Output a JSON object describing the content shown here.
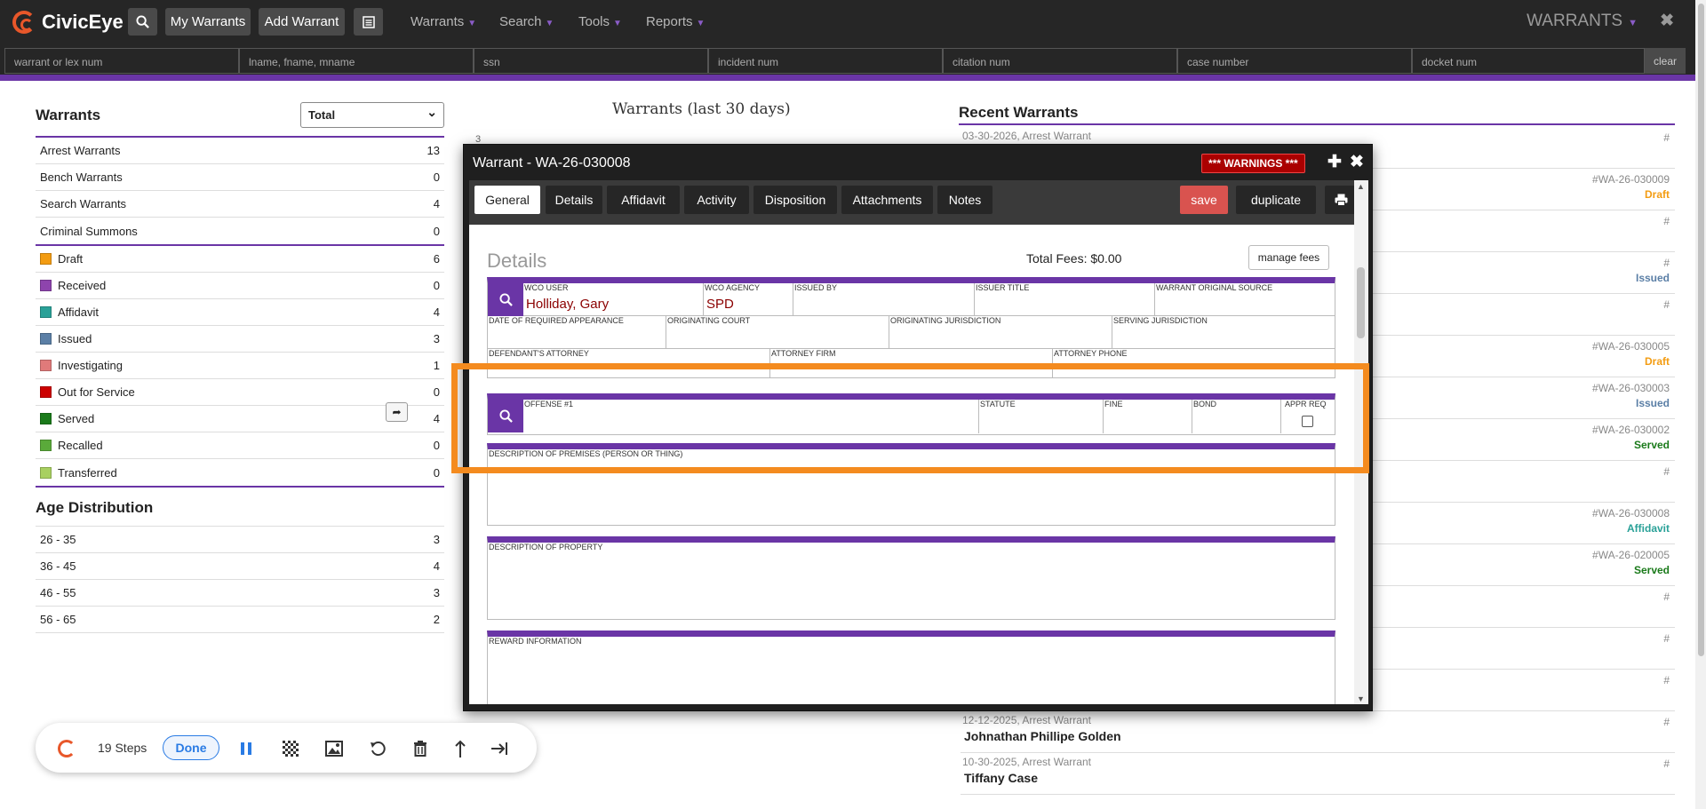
{
  "app": {
    "brand": "CivicEye",
    "module_title": "WARRANTS"
  },
  "topbar": {
    "my_warrants": "My Warrants",
    "add_warrant": "Add Warrant",
    "menus": [
      "Warrants",
      "Search",
      "Tools",
      "Reports"
    ]
  },
  "search": {
    "placeholders": [
      "warrant or lex num",
      "lname, fname, mname",
      "ssn",
      "incident num",
      "citation num",
      "case number",
      "docket num"
    ],
    "clear": "clear"
  },
  "left": {
    "title": "Warrants",
    "select_value": "Total",
    "types": [
      {
        "label": "Arrest Warrants",
        "count": "13"
      },
      {
        "label": "Bench Warrants",
        "count": "0"
      },
      {
        "label": "Search Warrants",
        "count": "4"
      },
      {
        "label": "Criminal Summons",
        "count": "0"
      }
    ],
    "statuses": [
      {
        "label": "Draft",
        "count": "6",
        "color": "#f39c12"
      },
      {
        "label": "Received",
        "count": "0",
        "color": "#8e44ad"
      },
      {
        "label": "Affidavit",
        "count": "4",
        "color": "#2aa198"
      },
      {
        "label": "Issued",
        "count": "3",
        "color": "#5b7fa6"
      },
      {
        "label": "Investigating",
        "count": "1",
        "color": "#e07a7a"
      },
      {
        "label": "Out for Service",
        "count": "0",
        "color": "#cc0000"
      },
      {
        "label": "Served",
        "count": "4",
        "color": "#1a7a1a"
      },
      {
        "label": "Recalled",
        "count": "0",
        "color": "#5aaa3a"
      },
      {
        "label": "Transferred",
        "count": "0",
        "color": "#a8d060"
      }
    ],
    "age_title": "Age Distribution",
    "ages": [
      {
        "label": "26 - 35",
        "count": "3"
      },
      {
        "label": "36 - 45",
        "count": "4"
      },
      {
        "label": "46 - 55",
        "count": "3"
      },
      {
        "label": "56 - 65",
        "count": "2"
      }
    ]
  },
  "chart": {
    "title": "Warrants (last 30 days)",
    "tick": "3"
  },
  "recent": {
    "title": "Recent Warrants",
    "items": [
      {
        "date": "03-30-2026, Arrest Warrant",
        "name": "",
        "num": "#",
        "status": "",
        "status_color": ""
      },
      {
        "date": "",
        "name": "",
        "num": "#WA-26-030009",
        "status": "Draft",
        "status_color": "#f39c12"
      },
      {
        "date": "",
        "name": "",
        "num": "#",
        "status": "",
        "status_color": ""
      },
      {
        "date": "",
        "name": "",
        "num": "#",
        "status": "Issued",
        "status_color": "#5b7fa6"
      },
      {
        "date": "",
        "name": "",
        "num": "#",
        "status": "",
        "status_color": ""
      },
      {
        "date": "",
        "name": "",
        "num": "#WA-26-030005",
        "status": "Draft",
        "status_color": "#f39c12"
      },
      {
        "date": "",
        "name": "",
        "num": "#WA-26-030003",
        "status": "Issued",
        "status_color": "#5b7fa6"
      },
      {
        "date": "",
        "name": "",
        "num": "#WA-26-030002",
        "status": "Served",
        "status_color": "#1a7a1a"
      },
      {
        "date": "",
        "name": "",
        "num": "#",
        "status": "",
        "status_color": ""
      },
      {
        "date": "",
        "name": "",
        "num": "#WA-26-030008",
        "status": "Affidavit",
        "status_color": "#2aa198"
      },
      {
        "date": "",
        "name": "",
        "num": "#WA-26-020005",
        "status": "Served",
        "status_color": "#1a7a1a"
      },
      {
        "date": "",
        "name": "",
        "num": "#",
        "status": "",
        "status_color": ""
      },
      {
        "date": "",
        "name": "",
        "num": "#",
        "status": "",
        "status_color": ""
      },
      {
        "date": "",
        "name": "",
        "num": "#",
        "status": "",
        "status_color": ""
      },
      {
        "date": "12-12-2025, Arrest Warrant",
        "name": "Johnathan Phillipe Golden",
        "num": "#",
        "status": "",
        "status_color": ""
      },
      {
        "date": "10-30-2025, Arrest Warrant",
        "name": "Tiffany Case",
        "num": "#",
        "status": "",
        "status_color": ""
      }
    ]
  },
  "modal": {
    "title": "Warrant - WA-26-030008",
    "warnings": "*** WARNINGS ***",
    "tabs": [
      "General",
      "Details",
      "Affidavit",
      "Activity",
      "Disposition",
      "Attachments",
      "Notes"
    ],
    "save": "save",
    "duplicate": "duplicate",
    "details_title": "Details",
    "total_fees": "Total Fees: $0.00",
    "manage_fees": "manage fees",
    "row1": [
      {
        "label": "WCO USER",
        "value": "Holliday, Gary"
      },
      {
        "label": "WCO AGENCY",
        "value": "SPD"
      },
      {
        "label": "ISSUED BY",
        "value": ""
      },
      {
        "label": "ISSUER TITLE",
        "value": ""
      },
      {
        "label": "WARRANT ORIGINAL SOURCE",
        "value": ""
      }
    ],
    "row2": [
      "DATE OF REQUIRED APPEARANCE",
      "ORIGINATING COURT",
      "ORIGINATING JURISDICTION",
      "SERVING JURISDICTION"
    ],
    "row3": [
      "DEFENDANT'S ATTORNEY",
      "ATTORNEY FIRM",
      "ATTORNEY PHONE"
    ],
    "offense": [
      "OFFENSE #1",
      "STATUTE",
      "FINE",
      "BOND",
      "APPR REQ"
    ],
    "premises": "DESCRIPTION OF PREMISES (PERSON OR THING)",
    "property": "DESCRIPTION OF PROPERTY",
    "reward": "REWARD INFORMATION"
  },
  "stepper": {
    "steps": "19 Steps",
    "done": "Done"
  }
}
